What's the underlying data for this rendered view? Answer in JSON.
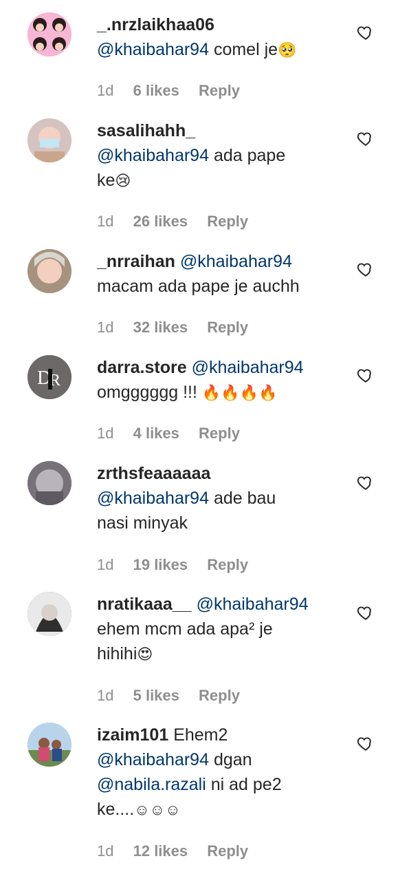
{
  "comments": [
    {
      "username": "_.nrzlaikhaa06",
      "mention": "@khaibahar94",
      "text_after": " comel je",
      "emoji": "🥺",
      "text_line2": "",
      "time": "1d",
      "likes": "6 likes",
      "reply": "Reply",
      "avatar_color": "#f1a6c8"
    },
    {
      "username": "sasalihahh_",
      "mention": "@khaibahar94",
      "text_after": " ada pape",
      "text_line2": "ke",
      "emoji": "😢",
      "time": "1d",
      "likes": "26 likes",
      "reply": "Reply",
      "avatar_color": "#d6b6b4"
    },
    {
      "username": "_nrraihan",
      "mention": "@khaibahar94",
      "text_line2": "macam ada pape je auchh",
      "time": "1d",
      "likes": "32 likes",
      "reply": "Reply",
      "avatar_color": "#b39a7a"
    },
    {
      "username": "darra.store",
      "mention": "@khaibahar94",
      "text_line2": "omgggggg !!!",
      "emoji": "🔥🔥🔥🔥",
      "time": "1d",
      "likes": "4 likes",
      "reply": "Reply",
      "avatar_color": "#6f6a6a"
    },
    {
      "username": "zrthsfeaaaaaa",
      "mention": "@khaibahar94",
      "text_after": " ade bau",
      "text_line2": "nasi minyak",
      "time": "1d",
      "likes": "19 likes",
      "reply": "Reply",
      "avatar_color": "#7f7b82"
    },
    {
      "username": "nratikaaa__",
      "mention": "@khaibahar94",
      "text_line2": "ehem mcm ada apa² je",
      "text_line3": "hihihi",
      "emoji": "😍",
      "time": "1d",
      "likes": "5 likes",
      "reply": "Reply",
      "avatar_color": "#5a5a5a"
    },
    {
      "username": "izaim101",
      "text_inline": " Ehem2",
      "mention": "@khaibahar94",
      "text_after": " dgan",
      "mention2": "@nabila.razali",
      "text_after2": " ni ad pe2",
      "text_line4": "ke....",
      "emoji": "☺☺☺",
      "time": "1d",
      "likes": "12 likes",
      "reply": "Reply",
      "avatar_color": "#8fb3cf"
    }
  ],
  "colors": {
    "text": "#262626",
    "mention": "#00376b",
    "meta": "#8e8e8e"
  },
  "icons": {
    "heart": "heart-outline-icon"
  }
}
